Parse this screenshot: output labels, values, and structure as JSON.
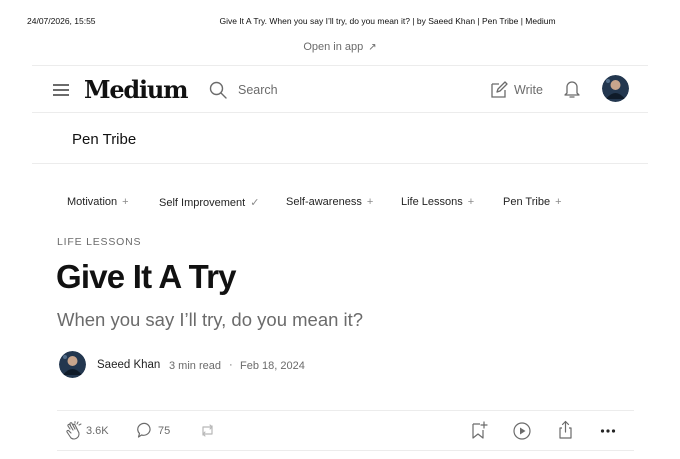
{
  "print_header": {
    "date": "24/07/2026, 15:55",
    "title": "Give It A Try. When you say I’ll try, do you mean it? | by Saeed Khan | Pen Tribe | Medium"
  },
  "banner": {
    "open_in_app": "Open in app",
    "arrow": "↗"
  },
  "nav": {
    "logo": "Medium",
    "search_label": "Search",
    "write_label": "Write"
  },
  "publication": {
    "name": "Pen Tribe"
  },
  "tags": [
    {
      "label": "Motivation",
      "symbol": "+"
    },
    {
      "label": "Self Improvement",
      "symbol": "✓"
    },
    {
      "label": "Self-awareness",
      "symbol": "+"
    },
    {
      "label": "Life Lessons",
      "symbol": "+"
    },
    {
      "label": "Pen Tribe",
      "symbol": "+"
    }
  ],
  "article": {
    "kicker": "LIFE LESSONS",
    "title": "Give It A Try",
    "subtitle": "When you say I’ll try, do you mean it?",
    "author": "Saeed Khan",
    "read_time": "3 min read",
    "separator": "·",
    "date": "Feb 18, 2024"
  },
  "actions": {
    "claps": "3.6K",
    "comments": "75"
  },
  "icons": {
    "menu": "hamburger-icon",
    "search": "search-icon",
    "write": "write-icon",
    "notifications": "bell-icon",
    "clap": "clap-icon",
    "comment": "comment-icon",
    "repost": "repost-icon",
    "save": "bookmark-add-icon",
    "listen": "play-icon",
    "share": "share-icon",
    "more": "more-icon"
  },
  "colors": {
    "text": "#242424",
    "muted": "#6b6b6b",
    "divider": "#ececec"
  }
}
